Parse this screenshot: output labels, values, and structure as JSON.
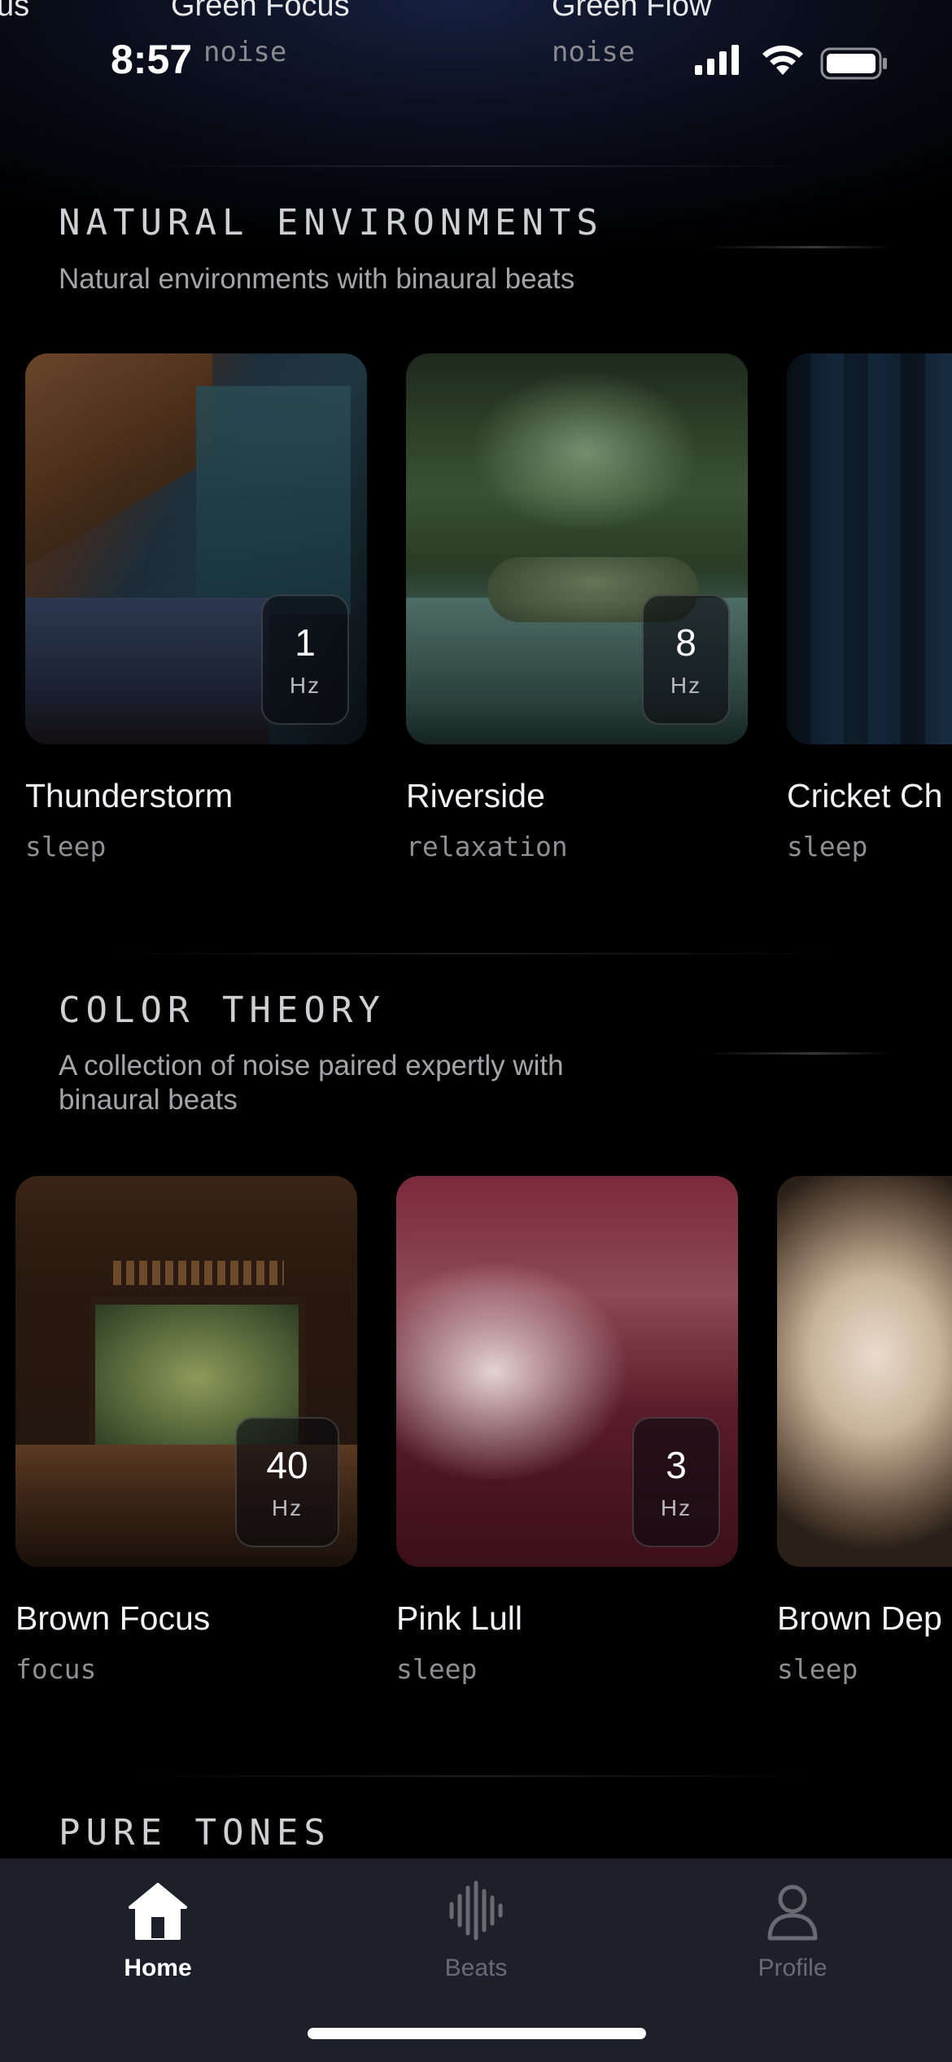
{
  "status_bar": {
    "time": "8:57"
  },
  "previous_section_peek": {
    "items": [
      {
        "title": "us",
        "tag": ""
      },
      {
        "title": "Green Focus",
        "tag": "noise"
      },
      {
        "title": "Green Flow",
        "tag": "noise"
      }
    ]
  },
  "sections": [
    {
      "title": "NATURAL ENVIRONMENTS",
      "description": "Natural environments with binaural beats",
      "cards": [
        {
          "title": "Thunderstorm",
          "tag": "sleep",
          "hz": "1",
          "hz_unit": "Hz"
        },
        {
          "title": "Riverside",
          "tag": "relaxation",
          "hz": "8",
          "hz_unit": "Hz"
        },
        {
          "title": "Cricket Ch",
          "tag": "sleep"
        }
      ]
    },
    {
      "title": "COLOR THEORY",
      "description": "A collection of noise paired expertly with binaural beats",
      "cards": [
        {
          "title": "Brown Focus",
          "tag": "focus",
          "hz": "40",
          "hz_unit": "Hz"
        },
        {
          "title": "Pink Lull",
          "tag": "sleep",
          "hz": "3",
          "hz_unit": "Hz"
        },
        {
          "title": "Brown Dep",
          "tag": "sleep"
        }
      ]
    },
    {
      "title": "PURE TONES"
    }
  ],
  "tab_bar": {
    "tabs": [
      {
        "label": "Home",
        "icon": "home-icon",
        "active": true
      },
      {
        "label": "Beats",
        "icon": "waveform-icon",
        "active": false
      },
      {
        "label": "Profile",
        "icon": "person-icon",
        "active": false
      }
    ]
  }
}
